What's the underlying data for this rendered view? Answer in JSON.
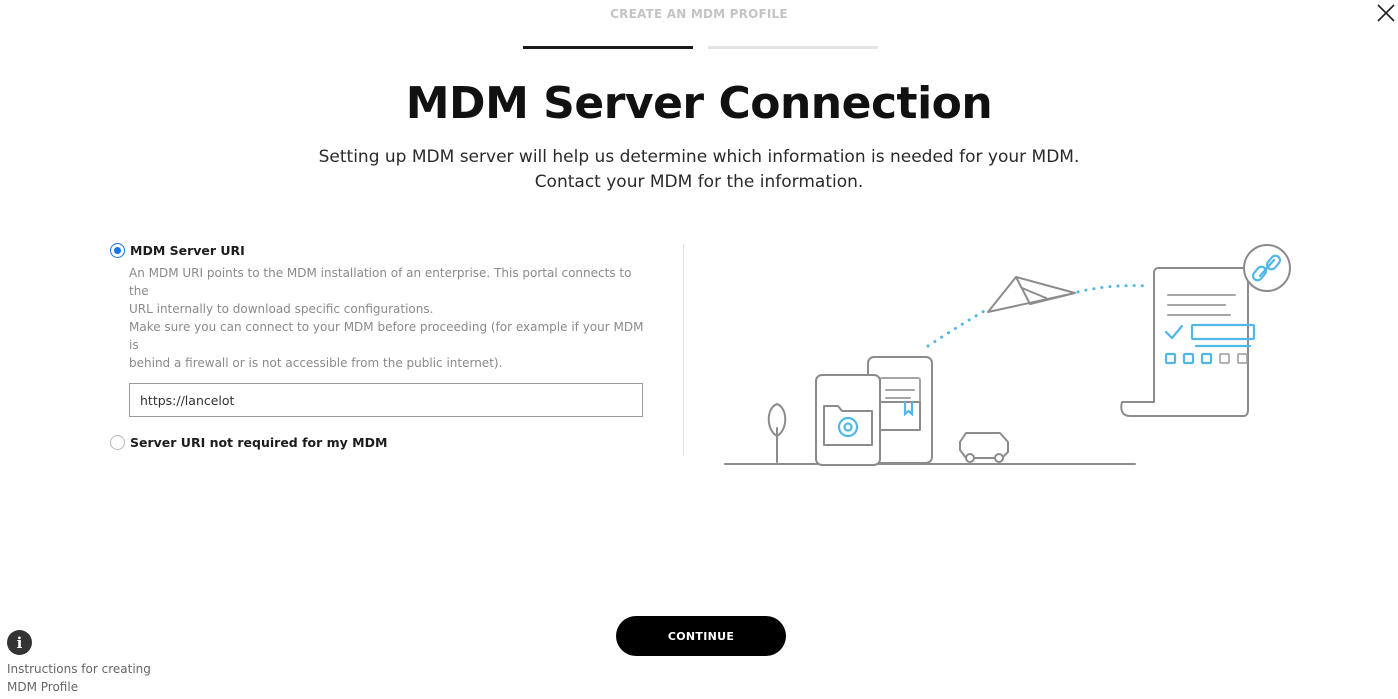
{
  "header": {
    "step_label": "CREATE AN MDM PROFILE",
    "close_icon": "close-icon"
  },
  "progress": {
    "current_step": 1,
    "total_steps": 2
  },
  "main": {
    "title": "MDM Server Connection",
    "subtitle_line1": "Setting up MDM server will help us determine which information is needed for your MDM.",
    "subtitle_line2": "Contact your MDM for the information."
  },
  "form": {
    "option1": {
      "label": "MDM Server URI",
      "selected": true,
      "description_line1": "An MDM URI points to the MDM installation of an enterprise. This portal connects to the",
      "description_line2": "URL internally to download specific configurations.",
      "description_line3": "Make sure you can connect to your MDM before proceeding (for example if your MDM is",
      "description_line4": "behind a firewall or is not accessible from the public internet).",
      "input_value": "https://lancelot"
    },
    "option2": {
      "label": "Server URI not required for my MDM",
      "selected": false
    }
  },
  "footer": {
    "continue_label": "CONTINUE",
    "help_icon": "info-icon",
    "help_line1": "Instructions for creating",
    "help_line2": "MDM Profile"
  },
  "colors": {
    "accent": "#1a73e8",
    "illustration_accent": "#4fb8e6",
    "button_bg": "#000000"
  }
}
